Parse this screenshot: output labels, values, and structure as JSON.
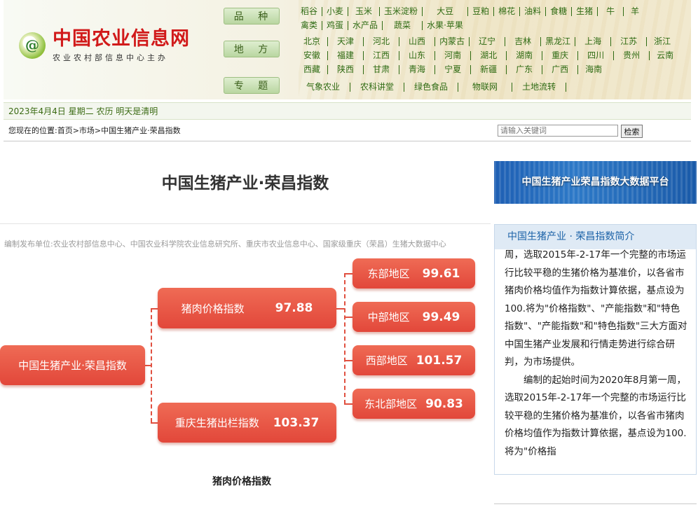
{
  "site": {
    "title": "中国农业信息网",
    "subtitle": "农业农村部信息中心主办",
    "logo_icon": "ai-logo-icon"
  },
  "categories": [
    {
      "label": "品 种",
      "links": [
        [
          "稻谷",
          "小麦",
          "玉米",
          "玉米淀粉",
          "大豆",
          "豆粕",
          "棉花",
          "油料",
          "食糖",
          "生猪",
          "牛",
          "羊"
        ],
        [
          "禽类",
          "鸡蛋",
          "水产品",
          "蔬菜",
          "水果·苹果"
        ]
      ]
    },
    {
      "label": "地 方",
      "links": [
        [
          "北京",
          "天津",
          "河北",
          "山西",
          "内蒙古",
          "辽宁",
          "吉林",
          "黑龙江",
          "上海",
          "江苏",
          "浙江"
        ],
        [
          "安徽",
          "福建",
          "江西",
          "山东",
          "河南",
          "湖北",
          "湖南",
          "重庆",
          "四川",
          "贵州",
          "云南"
        ],
        [
          "西藏",
          "陕西",
          "甘肃",
          "青海",
          "宁夏",
          "新疆",
          "广东",
          "广西",
          "海南"
        ]
      ]
    },
    {
      "label": "专 题",
      "links": [
        [
          "气象农业",
          "农科讲堂",
          "绿色食品",
          "物联网",
          "土地流转"
        ]
      ]
    }
  ],
  "date_text": "2023年4月4日 星期二 农历 明天是清明",
  "breadcrumb": "您现在的位置:首页>市场>中国生猪产业·荣昌指数",
  "search": {
    "placeholder": "请输入关键词",
    "button": "检索"
  },
  "main_title": "中国生猪产业·荣昌指数",
  "banner_text": "中国生猪产业荣昌指数大数据平台",
  "compiler_text": "编制发布单位:农业农村部信息中心、中国农业科学院农业信息研究所、重庆市农业信息中心、国家级重庆（荣昌）生猪大数据中心",
  "index_tree": {
    "root": {
      "name": "中国生猪产业·荣昌指数"
    },
    "pork_price": {
      "name": "猪肉价格指数",
      "value": "97.88"
    },
    "chongqing": {
      "name": "重庆生猪出栏指数",
      "value": "103.37"
    },
    "regions": [
      {
        "name": "东部地区",
        "value": "99.61"
      },
      {
        "name": "中部地区",
        "value": "99.49"
      },
      {
        "name": "西部地区",
        "value": "101.57"
      },
      {
        "name": "东北部地区",
        "value": "90.83"
      }
    ]
  },
  "chart_caption": "猪肉价格指数",
  "intro": {
    "heading": "中国生猪产业 · 荣昌指数简介",
    "paragraphs": [
      "周，选取2015年-2-17年一个完整的市场运行比较平稳的生猪价格为基准价，以各省市猪肉价格均值作为指数计算依据，基点设为100.将为\"价格指数\"、\"产能指数\"和\"特色指数\"、\"产能指数\"和\"特色指数\"三大方面对中国生猪产业发展和行情走势进行综合研判，为市场提供。",
      "编制的起始时间为2020年8月第一周，选取2015年-2-17年一个完整的市场运行比较平稳的生猪价格为基准价，以各省市猪肉价格均值作为指数计算依据，基点设为100.将为\"价格指"
    ]
  },
  "colors": {
    "node": "#e6503f",
    "link_green": "#2f6b13",
    "title_red": "#d11a1a"
  }
}
